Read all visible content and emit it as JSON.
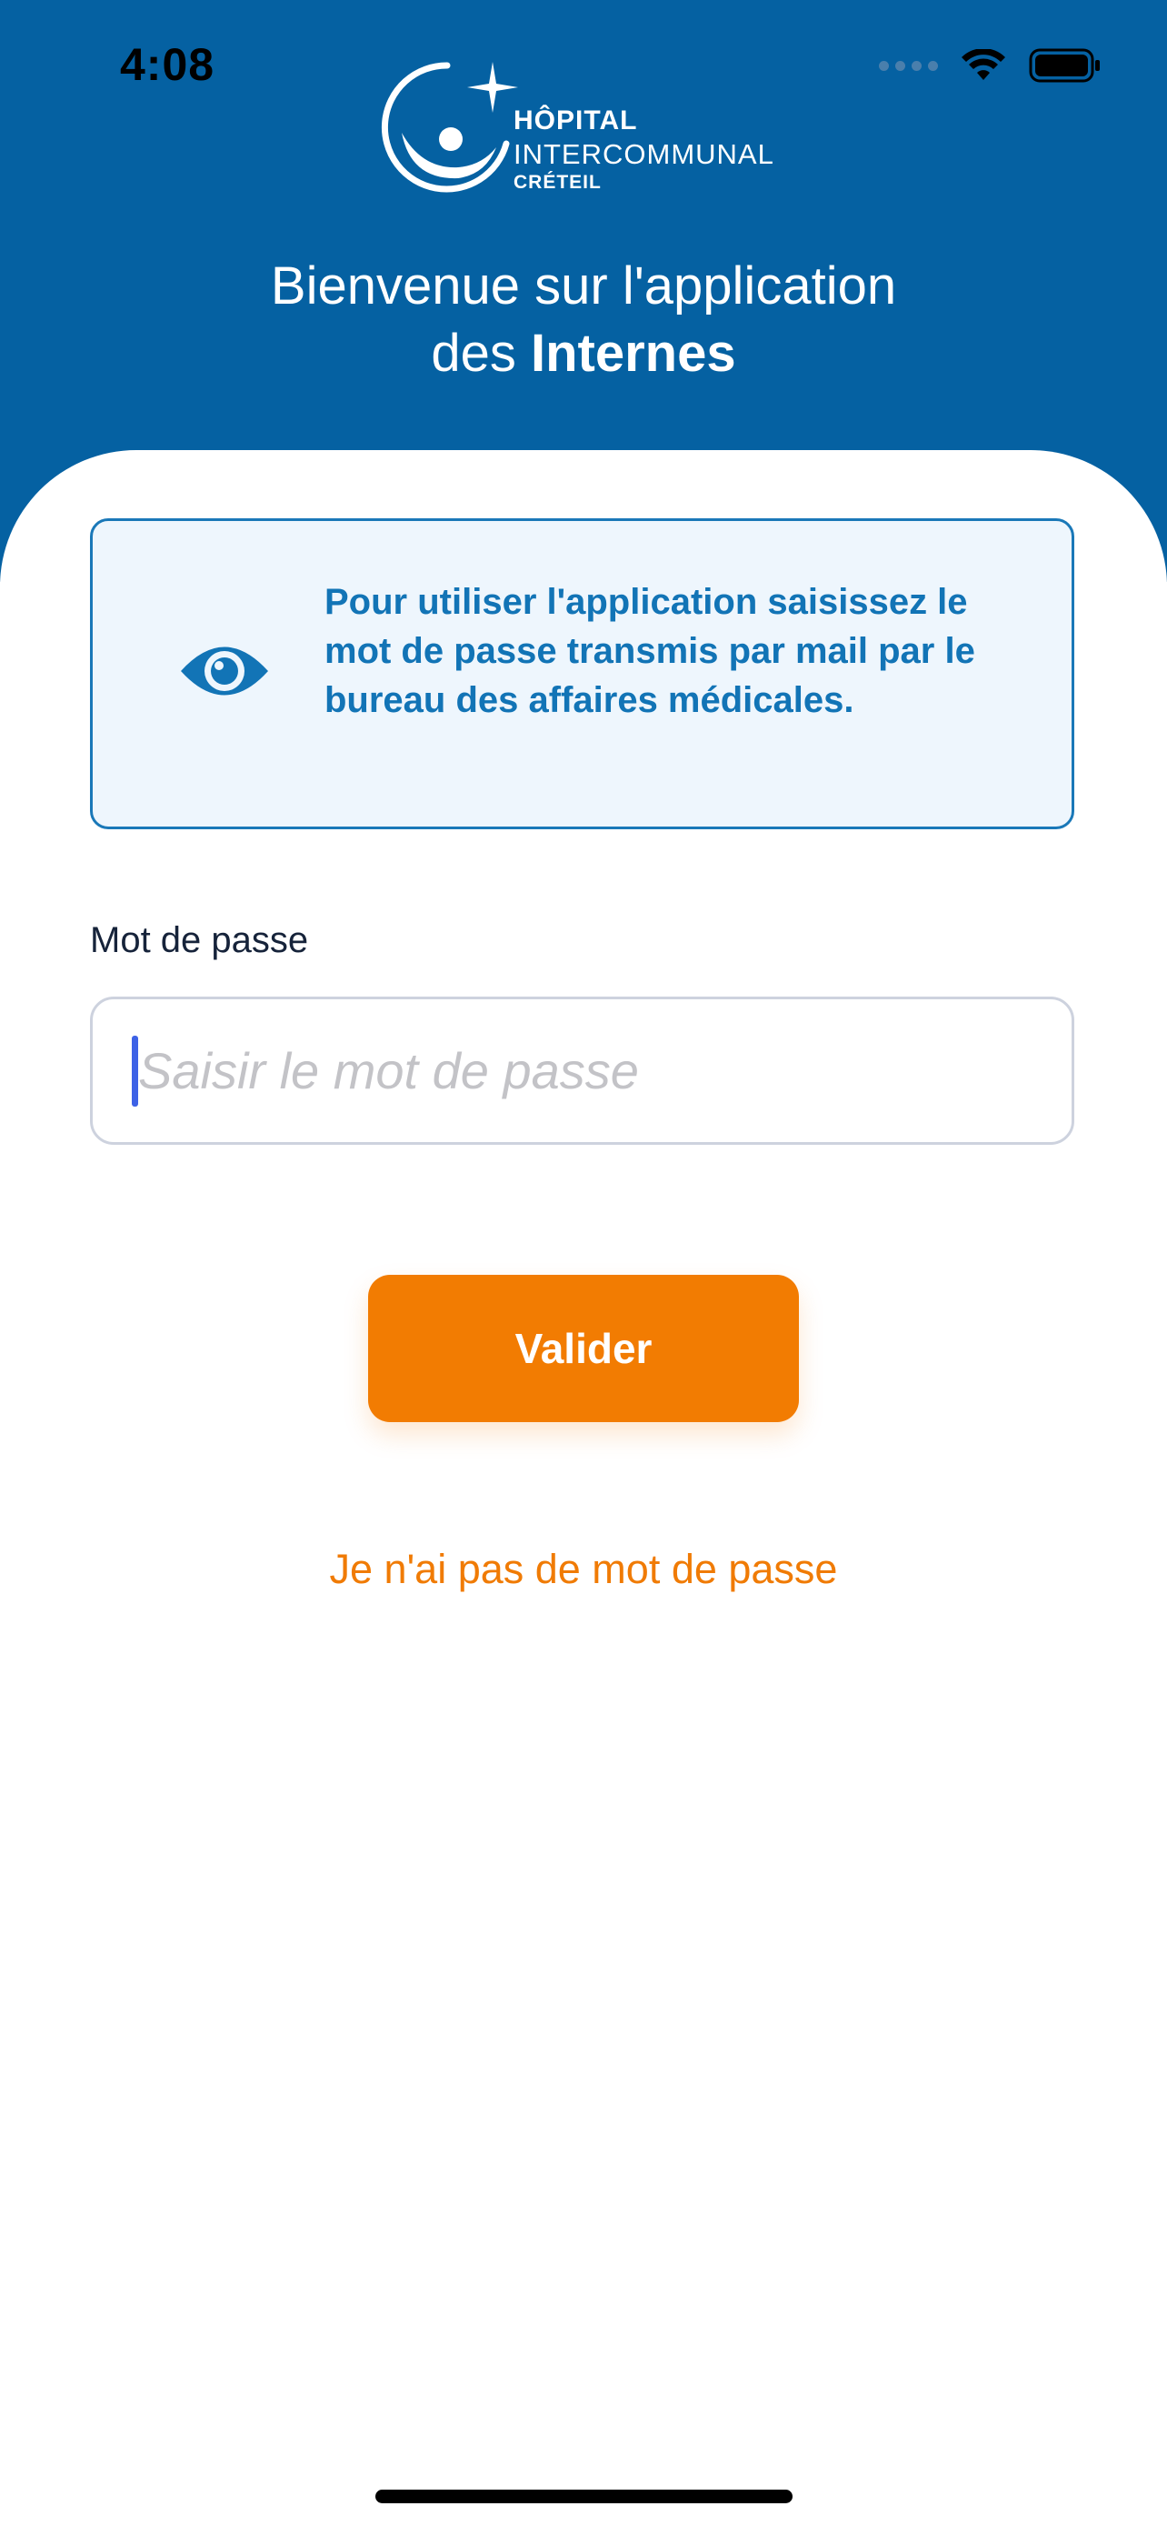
{
  "status_bar": {
    "time": "4:08",
    "icons": [
      "signal-dots-icon",
      "wifi-icon",
      "battery-icon"
    ]
  },
  "logo": {
    "line1": "HÔPITAL",
    "line2": "INTERCOMMUNAL",
    "line3": "CRÉTEIL"
  },
  "welcome": {
    "line1": "Bienvenue sur l'application",
    "line2_prefix": "des",
    "line2_bold": "Internes"
  },
  "info_box": {
    "icon": "eye-icon",
    "text": "Pour utiliser l'application saisissez le mot de passe transmis par mail par le bureau des affaires médicales."
  },
  "password": {
    "label": "Mot de passe",
    "placeholder": "Saisir le mot de passe",
    "value": ""
  },
  "actions": {
    "validate_label": "Valider",
    "no_password_label": "Je n'ai pas de mot de passe"
  },
  "colors": {
    "header_blue": "#0561a2",
    "info_text_blue": "#1274b6",
    "info_bg": "#eef6fd",
    "accent_orange": "#f27c02",
    "caret_blue": "#3d62e6"
  }
}
